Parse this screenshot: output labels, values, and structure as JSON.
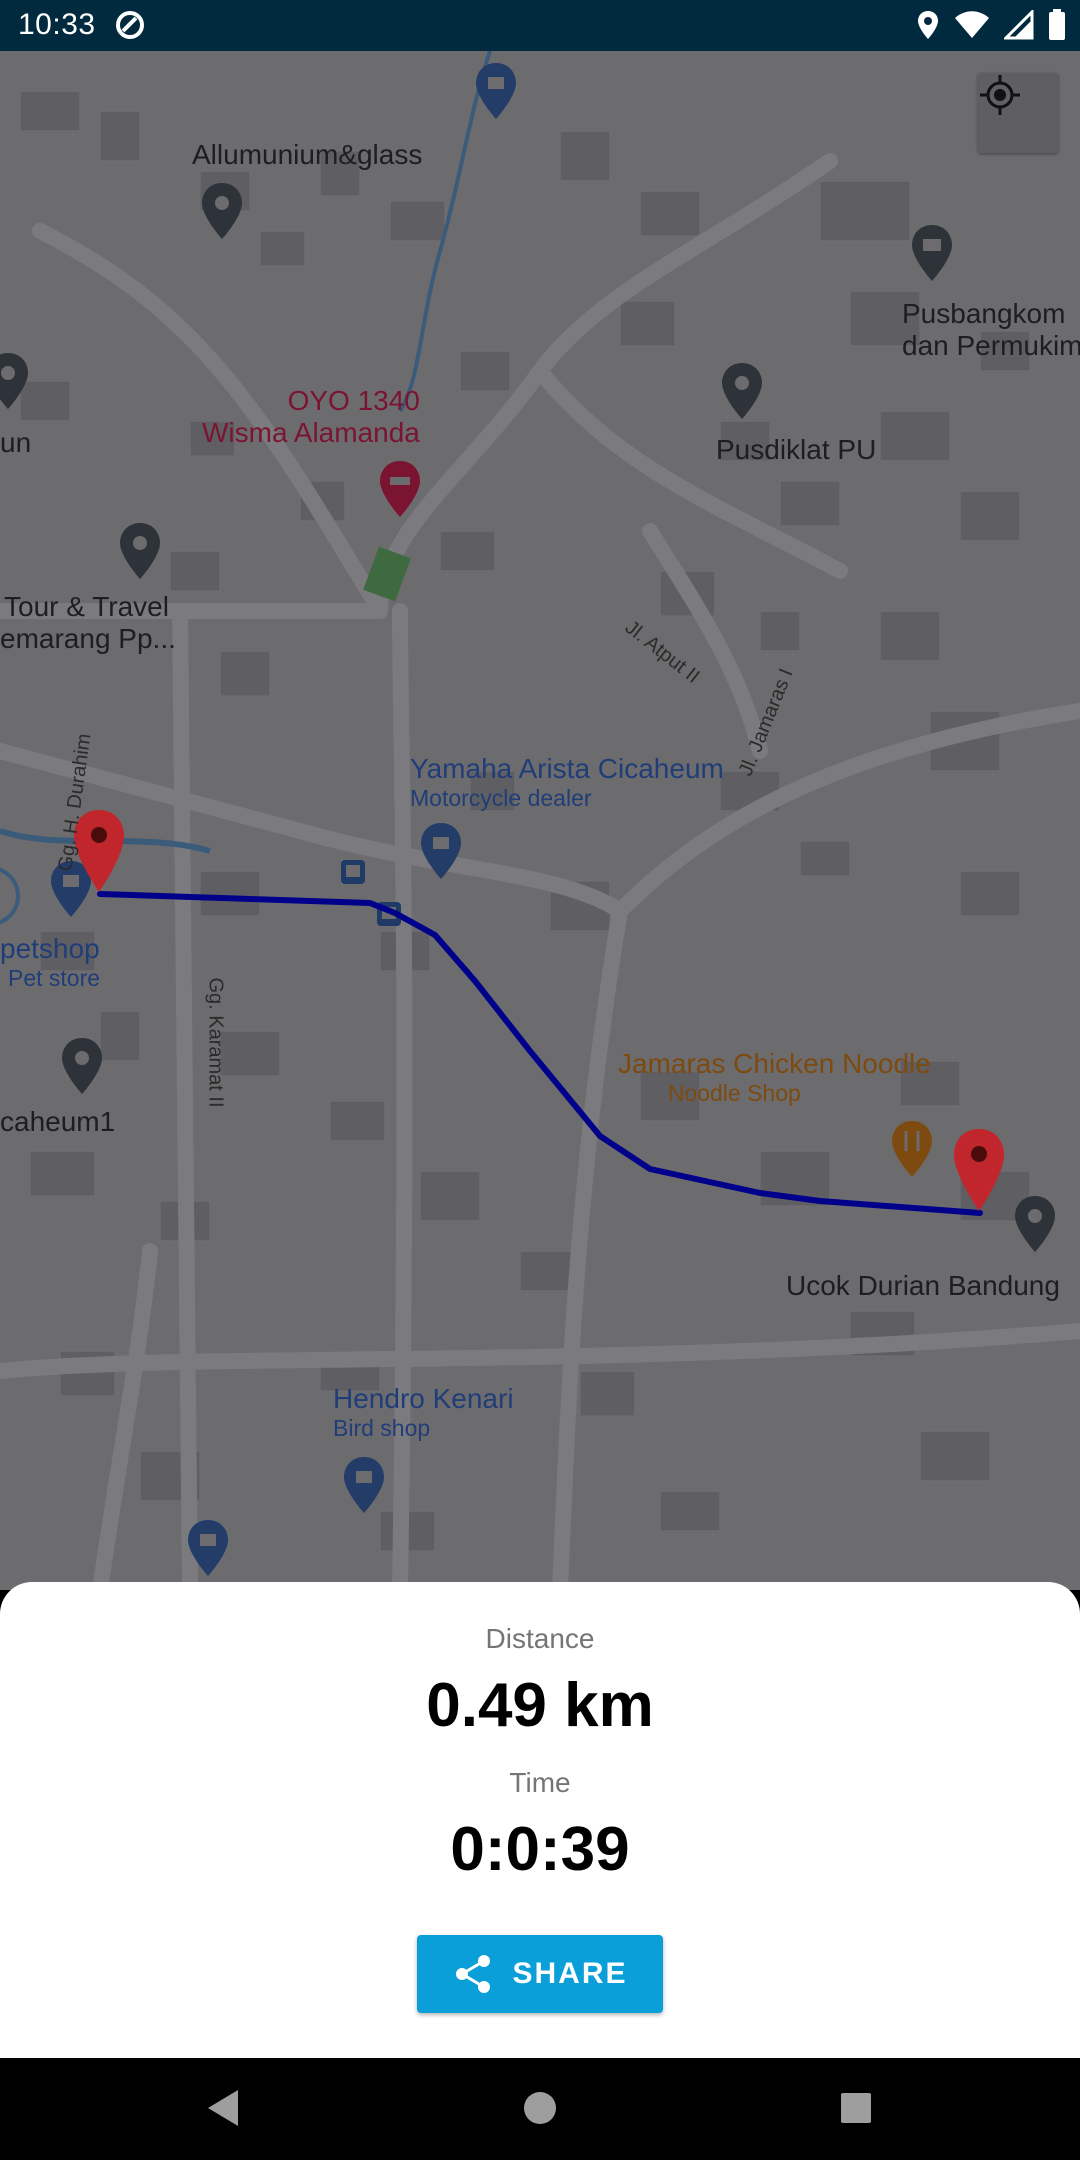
{
  "status_bar": {
    "time": "10:33",
    "left_icon": "do-not-disturb-icon",
    "right_icons": [
      "location-icon",
      "wifi-icon",
      "signal-icon",
      "battery-icon"
    ]
  },
  "map": {
    "labels": {
      "allumunium": "Allumunium&glass",
      "pusbangkom_1": "Pusbangkom",
      "pusbangkom_2": "dan Permukim",
      "un": "un",
      "oyo_1": "OYO 1340",
      "oyo_2": "Wisma Alamanda",
      "pusdiklat": "Pusdiklat PU",
      "atput": "Jl. Atput II",
      "jamaras": "Jl. Jamaras I",
      "tour_1": "Tour & Travel",
      "tour_2": "emarang Pp...",
      "durahim": "Gg. H. Durahim",
      "yamaha_name": "Yamaha Arista Cicaheum",
      "yamaha_type": "Motorcycle dealer",
      "petshop_name": "petshop",
      "petshop_type": "Pet store",
      "karamat": "Gg. Karamat II",
      "caheum": "caheum1",
      "jamaras_chicken_name": "Jamaras Chicken Noodle",
      "jamaras_chicken_type": "Noodle Shop",
      "ucok": "Ucok Durian Bandung",
      "hendro_name": "Hendro Kenari",
      "hendro_type": "Bird shop"
    },
    "route_color": "#00008b",
    "marker_color": "#c0262b"
  },
  "summary": {
    "distance_label": "Distance",
    "distance_value": "0.49 km",
    "time_label": "Time",
    "time_value": "0:0:39",
    "share_label": "SHARE"
  },
  "colors": {
    "status_bar": "#012a3e",
    "share_button": "#0a9fd8"
  }
}
